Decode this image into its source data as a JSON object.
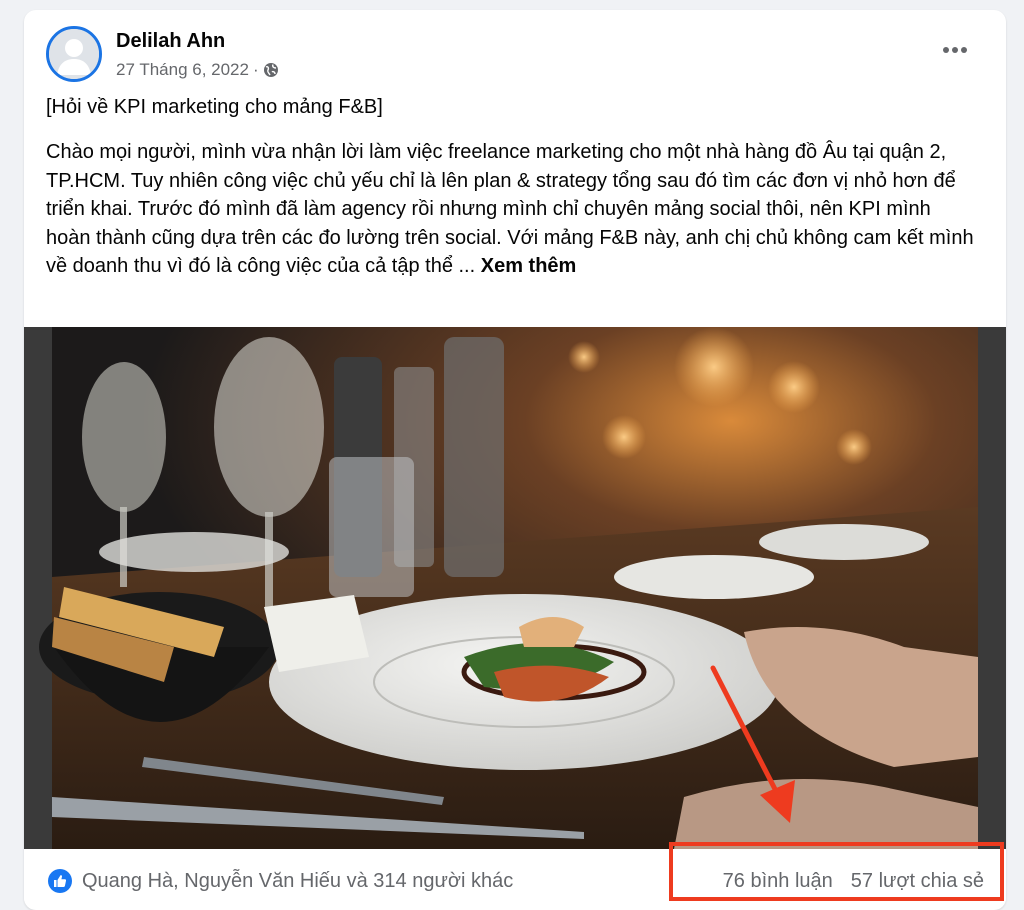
{
  "post": {
    "author": "Delilah Ahn",
    "date": "27 Tháng 6, 2022",
    "separator": "·",
    "privacy_icon": "globe-icon",
    "title": "[Hỏi về KPI marketing cho mảng F&B]",
    "body": "Chào mọi người, mình vừa nhận lời làm việc freelance marketing cho một nhà hàng đồ Âu tại quận 2, TP.HCM. Tuy nhiên công việc chủ yếu chỉ là lên plan & strategy tổng sau đó tìm các đơn vị nhỏ hơn để triển khai. Trước đó mình đã làm agency rồi nhưng mình chỉ chuyên mảng social thôi, nên KPI mình hoàn thành cũng dựa trên các đo lường trên social. Với mảng F&B này, anh chị chủ không cam kết mình về doanh thu vì đó là công việc của cả tập thể ...",
    "see_more": "Xem thêm",
    "more_icon": "more-options-icon"
  },
  "footer": {
    "reaction_icon": "like-icon",
    "reactions": "Quang Hà, Nguyễn Văn Hiếu và 314 người khác",
    "comments": "76 bình luận",
    "shares": "57 lượt chia sẻ"
  },
  "colors": {
    "accent": "#1877f2",
    "annotation": "#ee3b1f",
    "secondary_text": "#65676b"
  }
}
